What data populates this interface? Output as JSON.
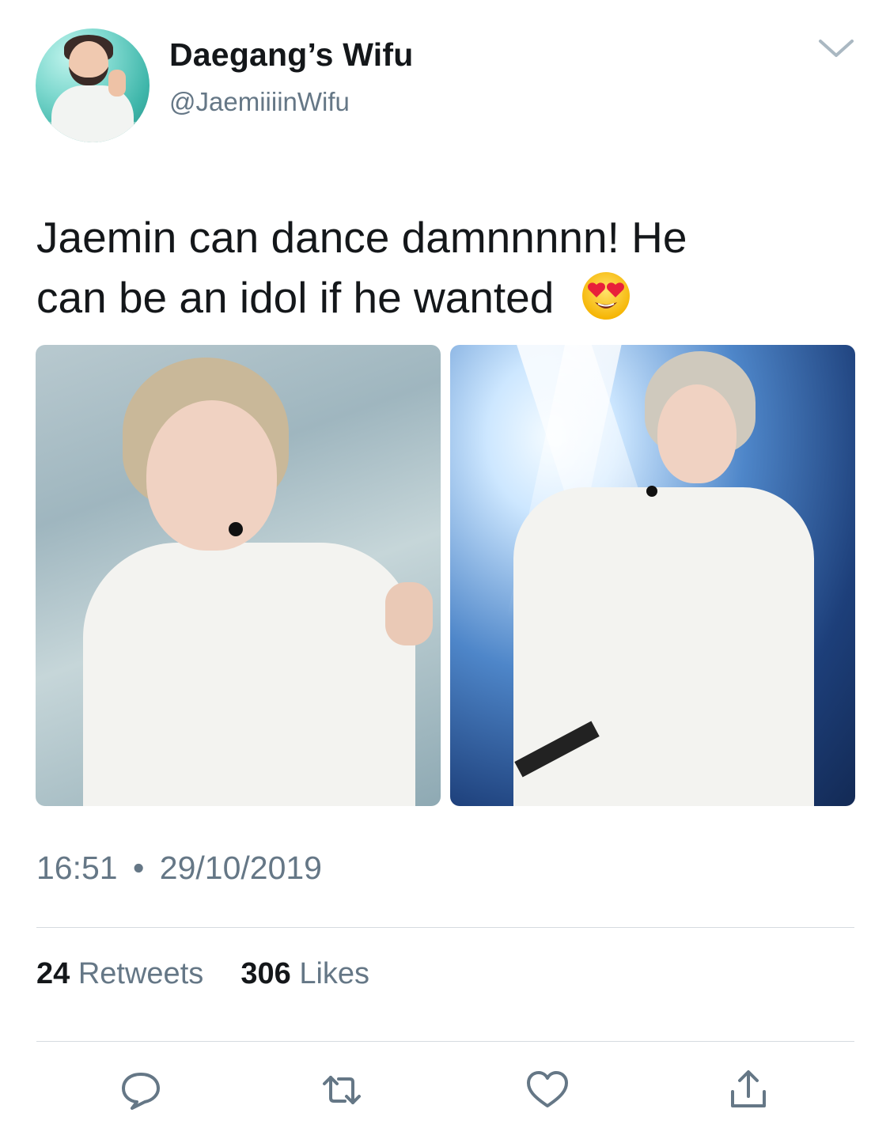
{
  "tweet": {
    "author_name": "Daegang’s Wifu",
    "author_handle": "@JaemiiiinWifu",
    "text_line1": "Jaemin can dance damnnnnn! He",
    "text_line2": "can be an idol if he wanted",
    "emoji": "smiling-face-with-heart-eyes",
    "time": "16:51",
    "separator": "•",
    "date": "29/10/2019"
  },
  "stats": {
    "retweets_count": "24",
    "retweets_label": "Retweets",
    "likes_count": "306",
    "likes_label": "Likes"
  },
  "actions": [
    "reply-icon",
    "retweet-icon",
    "like-icon",
    "share-icon"
  ],
  "colors": {
    "text": "#14171a",
    "secondary": "#657786",
    "divider": "#d6dbe0"
  }
}
